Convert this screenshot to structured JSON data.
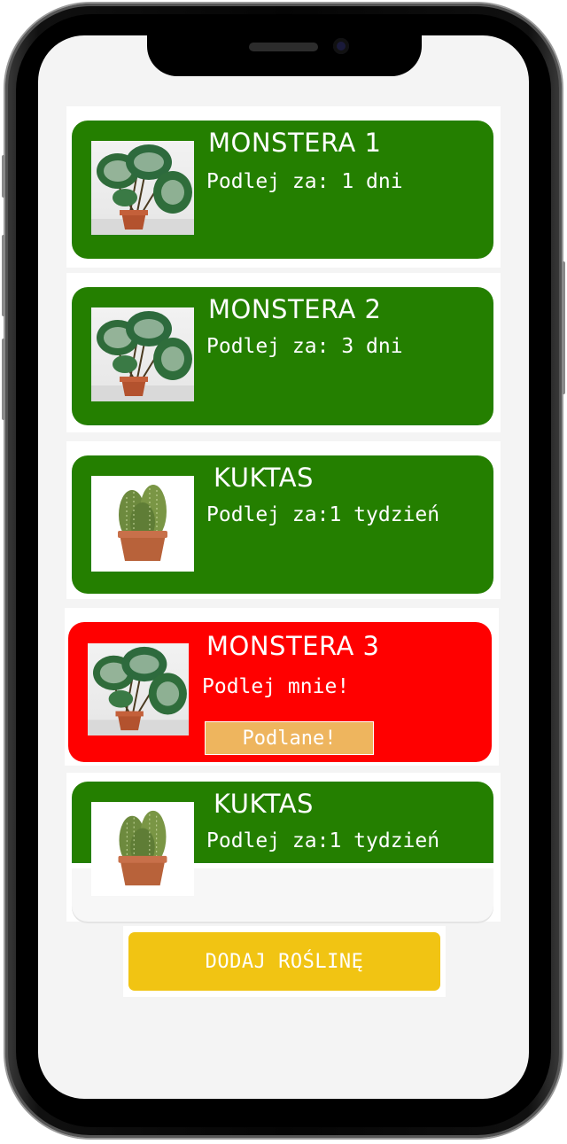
{
  "plants": [
    {
      "title": "MONSTERA 1",
      "info": "Podlej za:  1 dni",
      "type": "monstera",
      "status": "ok"
    },
    {
      "title": "MONSTERA 2",
      "info": "Podlej za: 3 dni",
      "type": "monstera",
      "status": "ok"
    },
    {
      "title": "KUKTAS",
      "info": "Podlej za:1 tydzień",
      "type": "cactus",
      "status": "ok"
    },
    {
      "title": "MONSTERA 3",
      "info": "Podlej mnie!",
      "type": "monstera",
      "status": "needs-water",
      "action_label": "Podlane!"
    },
    {
      "title": "KUKTAS",
      "info": "Podlej za:1 tydzień",
      "type": "cactus",
      "status": "ok"
    }
  ],
  "add_button_label": "DODAJ ROŚLINĘ",
  "colors": {
    "ok": "#247f00",
    "needs_water": "#ff0000",
    "water_button": "#eeb55e",
    "add_button": "#f1c413"
  }
}
